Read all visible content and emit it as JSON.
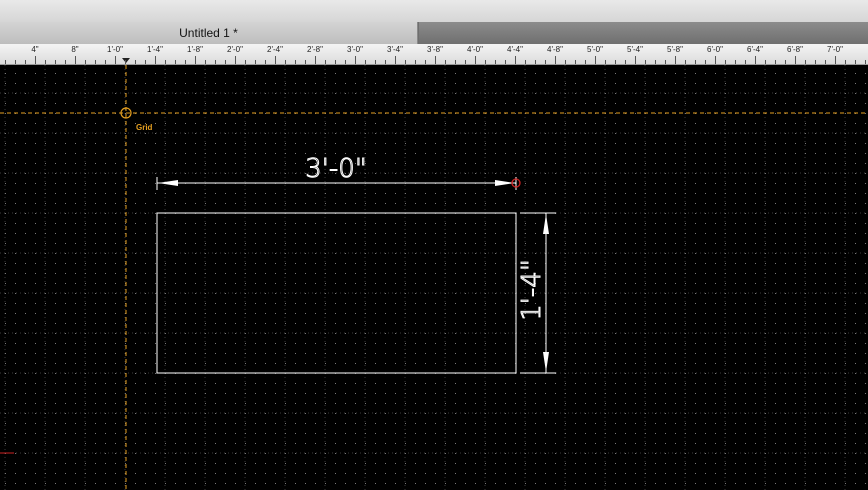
{
  "window": {
    "tab_title": "Untitled 1 *"
  },
  "ruler": {
    "labels": [
      "4\"",
      "8\"",
      "1'-0\"",
      "1'-4\"",
      "1'-8\"",
      "2'-0\"",
      "2'-4\"",
      "2'-8\"",
      "3'-0\"",
      "3'-4\"",
      "3'-8\"",
      "4'-0\"",
      "4'-4\"",
      "4'-8\"",
      "5'-0\"",
      "5'-4\"",
      "5'-8\"",
      "6'-0\"",
      "6'-4\"",
      "6'-8\"",
      "7'-0\""
    ]
  },
  "canvas": {
    "guide_label": "Grid",
    "width_dimension": "3'-0\"",
    "height_dimension": "1'-4\""
  },
  "colors": {
    "background": "#000000",
    "grid_lines": "#3a3a3a",
    "grid_dots": "#7a7a7a",
    "guide": "#e6a020",
    "geometry": "#ffffff",
    "snap_point": "#cc2222"
  }
}
